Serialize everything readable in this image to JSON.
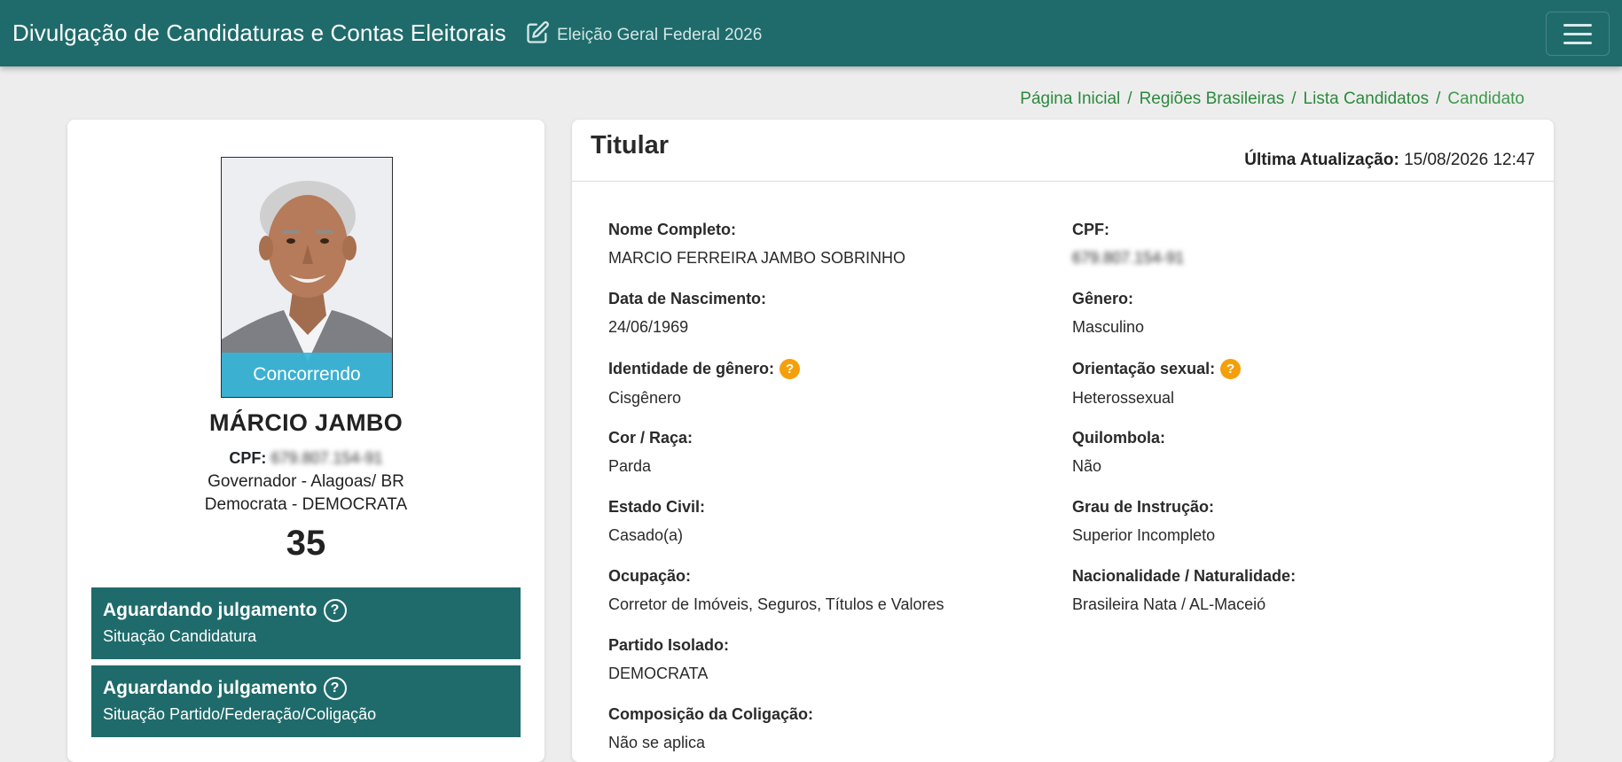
{
  "header": {
    "title": "Divulgação de Candidaturas e Contas Eleitorais",
    "election": "Eleição Geral Federal 2026",
    "edit_icon": "edit-square-icon",
    "menu_icon": "hamburger-menu-icon"
  },
  "breadcrumb": {
    "items": [
      "Página Inicial",
      "Regiões Brasileiras",
      "Lista Candidatos"
    ],
    "current": "Candidato",
    "separator": "/"
  },
  "candidate": {
    "photo_status": "Concorrendo",
    "name": "MÁRCIO JAMBO",
    "cpf_label": "CPF:",
    "cpf_value": "679.807.154-91",
    "office": "Governador - Alagoas/ BR",
    "party": "Democrata - DEMOCRATA",
    "number": "35",
    "status_candidatura": {
      "title": "Aguardando julgamento",
      "subtitle": "Situação Candidatura"
    },
    "status_partido": {
      "title": "Aguardando julgamento",
      "subtitle": "Situação Partido/Federação/Coligação"
    }
  },
  "details": {
    "title": "Titular",
    "updated_label": "Última Atualização:",
    "updated_value": "15/08/2026 12:47",
    "fields": {
      "nome_label": "Nome Completo:",
      "nome_value": "MARCIO FERREIRA JAMBO SOBRINHO",
      "cpf_label": "CPF:",
      "cpf_value": "679.807.154-91",
      "nascimento_label": "Data de Nascimento:",
      "nascimento_value": "24/06/1969",
      "genero_label": "Gênero:",
      "genero_value": "Masculino",
      "identidade_label": "Identidade de gênero:",
      "identidade_value": "Cisgênero",
      "orientacao_label": "Orientação sexual:",
      "orientacao_value": "Heterossexual",
      "cor_label": "Cor / Raça:",
      "cor_value": "Parda",
      "quilombola_label": "Quilombola:",
      "quilombola_value": "Não",
      "estado_civil_label": "Estado Civil:",
      "estado_civil_value": "Casado(a)",
      "instrucao_label": "Grau de Instrução:",
      "instrucao_value": "Superior Incompleto",
      "ocupacao_label": "Ocupação:",
      "ocupacao_value": "Corretor de Imóveis, Seguros, Títulos e Valores",
      "nacionalidade_label": "Nacionalidade / Naturalidade:",
      "nacionalidade_value": "Brasileira Nata / AL-Maceió",
      "partido_label": "Partido Isolado:",
      "partido_value": "DEMOCRATA",
      "coligacao_label": "Composição da Coligação:",
      "coligacao_value": "Não se aplica"
    }
  },
  "colors": {
    "primary": "#1f6b6b",
    "breadcrumb": "#2b8a3e",
    "status_badge": "#36b4d8",
    "help_icon": "#f5a00a"
  }
}
